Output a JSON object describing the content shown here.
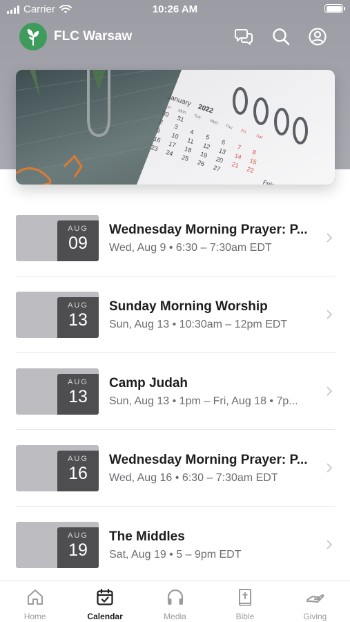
{
  "status_bar": {
    "carrier": "Carrier",
    "time": "10:26 AM"
  },
  "header": {
    "title": "FLC Warsaw",
    "icons": [
      "chat-icon",
      "search-icon",
      "profile-icon"
    ]
  },
  "hero": {
    "calendar_month": "January",
    "calendar_year": "2022",
    "next_month": "February",
    "weekday_headers": [
      "Sun",
      "Mon",
      "Tue",
      "Wed",
      "Thu",
      "Fri",
      "Sat"
    ]
  },
  "events": [
    {
      "month": "AUG",
      "day": "09",
      "title": "Wednesday Morning Prayer: P...",
      "subtitle": "Wed, Aug 9 • 6:30 – 7:30am EDT"
    },
    {
      "month": "AUG",
      "day": "13",
      "title": "Sunday Morning Worship",
      "subtitle": "Sun, Aug 13 • 10:30am – 12pm EDT"
    },
    {
      "month": "AUG",
      "day": "13",
      "title": "Camp Judah",
      "subtitle": "Sun, Aug 13 • 1pm – Fri, Aug 18 • 7p..."
    },
    {
      "month": "AUG",
      "day": "16",
      "title": "Wednesday Morning Prayer: P...",
      "subtitle": "Wed, Aug 16 • 6:30 – 7:30am EDT"
    },
    {
      "month": "AUG",
      "day": "19",
      "title": "The Middles",
      "subtitle": "Sat, Aug 19 • 5 – 9pm EDT"
    }
  ],
  "tabs": [
    {
      "label": "Home",
      "icon": "home-icon",
      "active": false
    },
    {
      "label": "Calendar",
      "icon": "calendar-icon",
      "active": true
    },
    {
      "label": "Media",
      "icon": "headphones-icon",
      "active": false
    },
    {
      "label": "Bible",
      "icon": "bible-icon",
      "active": false
    },
    {
      "label": "Giving",
      "icon": "giving-icon",
      "active": false
    }
  ],
  "colors": {
    "header_bg": "#a3a3ab",
    "logo_green": "#3f9b5b",
    "date_box": "#4e4e51",
    "date_tile": "#bdbdc1",
    "tab_inactive": "#9b9ba0",
    "tab_active": "#1d1d1f"
  }
}
